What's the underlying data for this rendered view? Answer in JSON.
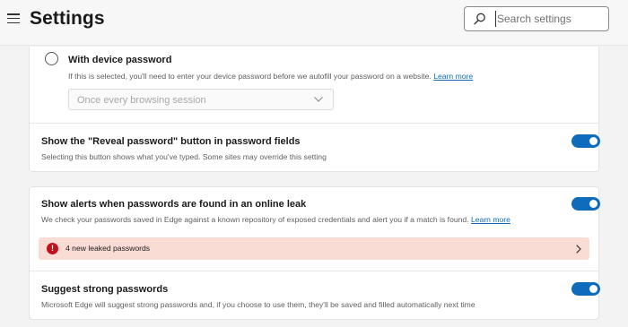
{
  "header": {
    "title": "Settings",
    "search_placeholder": "Search settings"
  },
  "device_password": {
    "label": "With device password",
    "description": "If this is selected, you'll need to enter your device password before we autofill your password on a website.",
    "learn_more": "Learn more",
    "frequency_value": "Once every browsing session"
  },
  "reveal_password": {
    "title": "Show the \"Reveal password\" button in password fields",
    "description": "Selecting this button shows what you've typed. Some sites may override this setting",
    "enabled": true
  },
  "leak_alerts": {
    "title": "Show alerts when passwords are found in an online leak",
    "description": "We check your passwords saved in Edge against a known repository of exposed credentials and alert you if a match is found.",
    "learn_more": "Learn more",
    "enabled": true,
    "alert_text": "4 new leaked passwords"
  },
  "strong_passwords": {
    "title": "Suggest strong passwords",
    "description": "Microsoft Edge will suggest strong passwords and, if you choose to use them, they'll be saved and filled automatically next time",
    "enabled": true
  },
  "icons": {
    "menu": "hamburger-menu-icon",
    "search": "search-icon",
    "dropdown": "chevron-down-icon",
    "alert": "error-icon",
    "navigate": "chevron-right-icon"
  },
  "colors": {
    "accent": "#0f6cbd",
    "alert_background": "#f9dcd3",
    "alert_icon": "#c50f1f"
  }
}
